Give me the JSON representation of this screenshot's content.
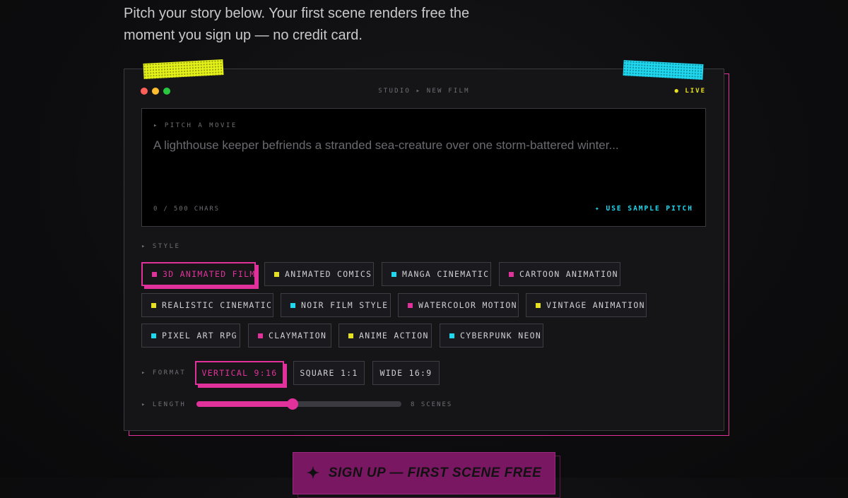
{
  "intro": {
    "line1": "Pitch your story below. Your first scene renders free the",
    "line2": "moment you sign up — no credit card."
  },
  "window": {
    "traffic_lights": [
      "#ff5f57",
      "#febc2e",
      "#28c840"
    ],
    "breadcrumb": "STUDIO ▸ NEW FILM",
    "live_badge": "● LIVE"
  },
  "pitch": {
    "label": "▸ PITCH A MOVIE",
    "value": "",
    "placeholder": "A lighthouse keeper befriends a stranded sea-creature over one storm-battered winter...",
    "char_count": "0 / 500 CHARS",
    "sample_button": "✦ USE SAMPLE PITCH"
  },
  "style": {
    "label": "▸ STYLE",
    "selected": "3D ANIMATED FILM",
    "options": [
      {
        "label": "3D ANIMATED FILM",
        "color": "#e0329a"
      },
      {
        "label": "ANIMATED COMICS",
        "color": "#e5e020"
      },
      {
        "label": "MANGA CINEMATIC",
        "color": "#1fd8f0"
      },
      {
        "label": "CARTOON ANIMATION",
        "color": "#e0329a"
      },
      {
        "label": "REALISTIC CINEMATIC",
        "color": "#e5e020"
      },
      {
        "label": "NOIR FILM STYLE",
        "color": "#1fd8f0"
      },
      {
        "label": "WATERCOLOR MOTION",
        "color": "#e0329a"
      },
      {
        "label": "VINTAGE ANIMATION",
        "color": "#e5e020"
      },
      {
        "label": "PIXEL ART RPG",
        "color": "#1fd8f0"
      },
      {
        "label": "CLAYMATION",
        "color": "#e0329a"
      },
      {
        "label": "ANIME ACTION",
        "color": "#e5e020"
      },
      {
        "label": "CYBERPUNK NEON",
        "color": "#1fd8f0"
      }
    ]
  },
  "format": {
    "label": "▸ FORMAT",
    "selected": "VERTICAL 9:16",
    "options": [
      "VERTICAL 9:16",
      "SQUARE 1:1",
      "WIDE 16:9"
    ]
  },
  "length": {
    "label": "▸ LENGTH",
    "fraction": 0.47,
    "value_label": "8 SCENES"
  },
  "cta": {
    "icon": "sparkle-icon",
    "label": "SIGN UP — FIRST SCENE FREE"
  },
  "colors": {
    "accent_pink": "#e0329a",
    "accent_yellow": "#e5e020",
    "accent_cyan": "#1fd8f0"
  }
}
